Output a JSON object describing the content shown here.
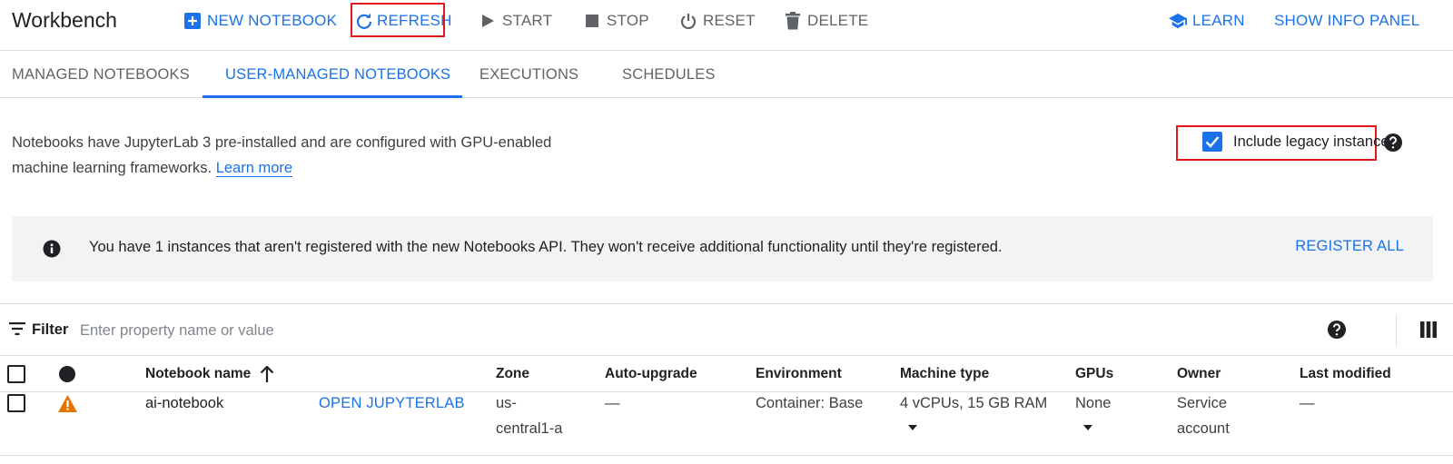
{
  "app": {
    "title": "Workbench"
  },
  "toolbar": {
    "new_notebook": "NEW NOTEBOOK",
    "refresh": "REFRESH",
    "start": "START",
    "stop": "STOP",
    "reset": "RESET",
    "delete": "DELETE",
    "learn": "LEARN",
    "show_info_panel": "SHOW INFO PANEL"
  },
  "tabs": [
    {
      "label": "MANAGED NOTEBOOKS",
      "active": false
    },
    {
      "label": "USER-MANAGED NOTEBOOKS",
      "active": true
    },
    {
      "label": "EXECUTIONS",
      "active": false
    },
    {
      "label": "SCHEDULES",
      "active": false
    }
  ],
  "description": {
    "line1": "Notebooks have JupyterLab 3 pre-installed and are configured with GPU-enabled",
    "line2": "machine learning frameworks.",
    "link": "Learn more"
  },
  "legacy": {
    "label": "Include legacy instances",
    "checked": true
  },
  "banner": {
    "message": "You have 1 instances that aren't registered with the new Notebooks API. They won't receive additional functionality until they're registered.",
    "action": "REGISTER ALL"
  },
  "filter": {
    "label": "Filter",
    "placeholder": "Enter property name or value"
  },
  "table": {
    "columns": [
      "Notebook name",
      "Zone",
      "Auto-upgrade",
      "Environment",
      "Machine type",
      "GPUs",
      "Owner",
      "Last modified"
    ],
    "rows": [
      {
        "name": "ai-notebook",
        "action": "OPEN JUPYTERLAB",
        "zone_line1": "us-",
        "zone_line2": "central1-a",
        "auto_upgrade": "—",
        "environment": "Container: Base",
        "machine_type": "4 vCPUs, 15 GB RAM",
        "gpus": "None",
        "owner_line1": "Service",
        "owner_line2": "account",
        "last_modified": "—"
      }
    ]
  },
  "colors": {
    "accent": "#1a73e8",
    "warning": "#e37400",
    "highlight": "#e3161b"
  }
}
